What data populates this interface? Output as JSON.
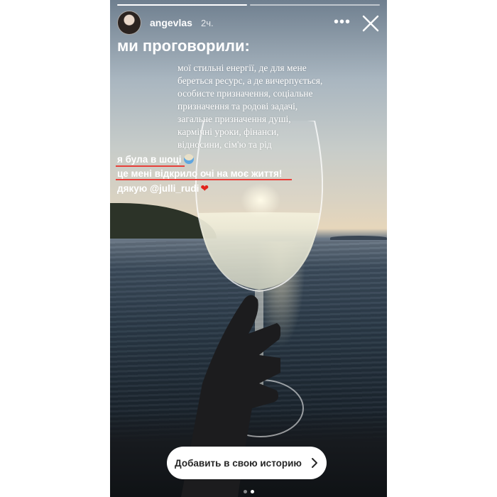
{
  "story": {
    "username": "angevlas",
    "time": "2ч.",
    "headline": "ми проговорили:",
    "body": "мої стильні енергії, де для мене береться ресурс, а де вичерпується, особисте призначення, соціальне призначення та родові задачі, загальне призначення душі, кармічні уроки, фінанси, відносини, сім'ю та рід",
    "line1": "я була в шоці",
    "line2": "це мені відкрило очі на моє життя!",
    "line3": "дякую @julli_rudi",
    "progress_segments": 2,
    "current_segment": 1
  },
  "cta": {
    "label": "Добавить в свою историю"
  },
  "icons": {
    "more": "more-horizontal-icon",
    "close": "close-icon",
    "chevron": "chevron-right-icon",
    "shocked_emoji": "face-screaming-in-fear-icon",
    "heart_emoji": "red-heart-icon"
  },
  "colors": {
    "underline": "#e8403a",
    "heart": "#e2241c"
  }
}
